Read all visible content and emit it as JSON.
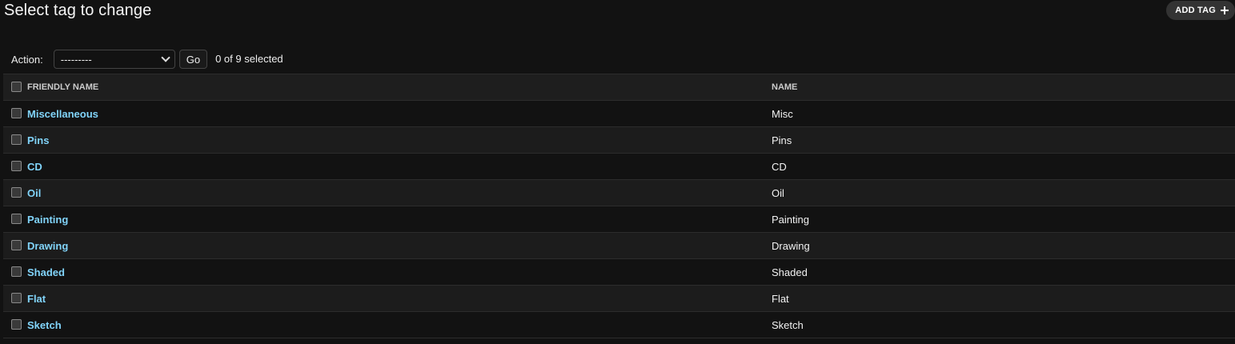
{
  "header": {
    "title": "Select tag to change",
    "add_button_label": "ADD TAG"
  },
  "actions": {
    "label": "Action:",
    "selected_option": "---------",
    "go_label": "Go",
    "counter": "0 of 9 selected"
  },
  "table": {
    "columns": [
      "FRIENDLY NAME",
      "NAME"
    ],
    "rows": [
      {
        "friendly_name": "Miscellaneous",
        "name": "Misc"
      },
      {
        "friendly_name": "Pins",
        "name": "Pins"
      },
      {
        "friendly_name": "CD",
        "name": "CD"
      },
      {
        "friendly_name": "Oil",
        "name": "Oil"
      },
      {
        "friendly_name": "Painting",
        "name": "Painting"
      },
      {
        "friendly_name": "Drawing",
        "name": "Drawing"
      },
      {
        "friendly_name": "Shaded",
        "name": "Shaded"
      },
      {
        "friendly_name": "Flat",
        "name": "Flat"
      },
      {
        "friendly_name": "Sketch",
        "name": "Sketch"
      }
    ]
  },
  "colors": {
    "background": "#121212",
    "row_alt": "#1c1c1c",
    "link": "#81d4fa",
    "button_bg": "#333333"
  }
}
